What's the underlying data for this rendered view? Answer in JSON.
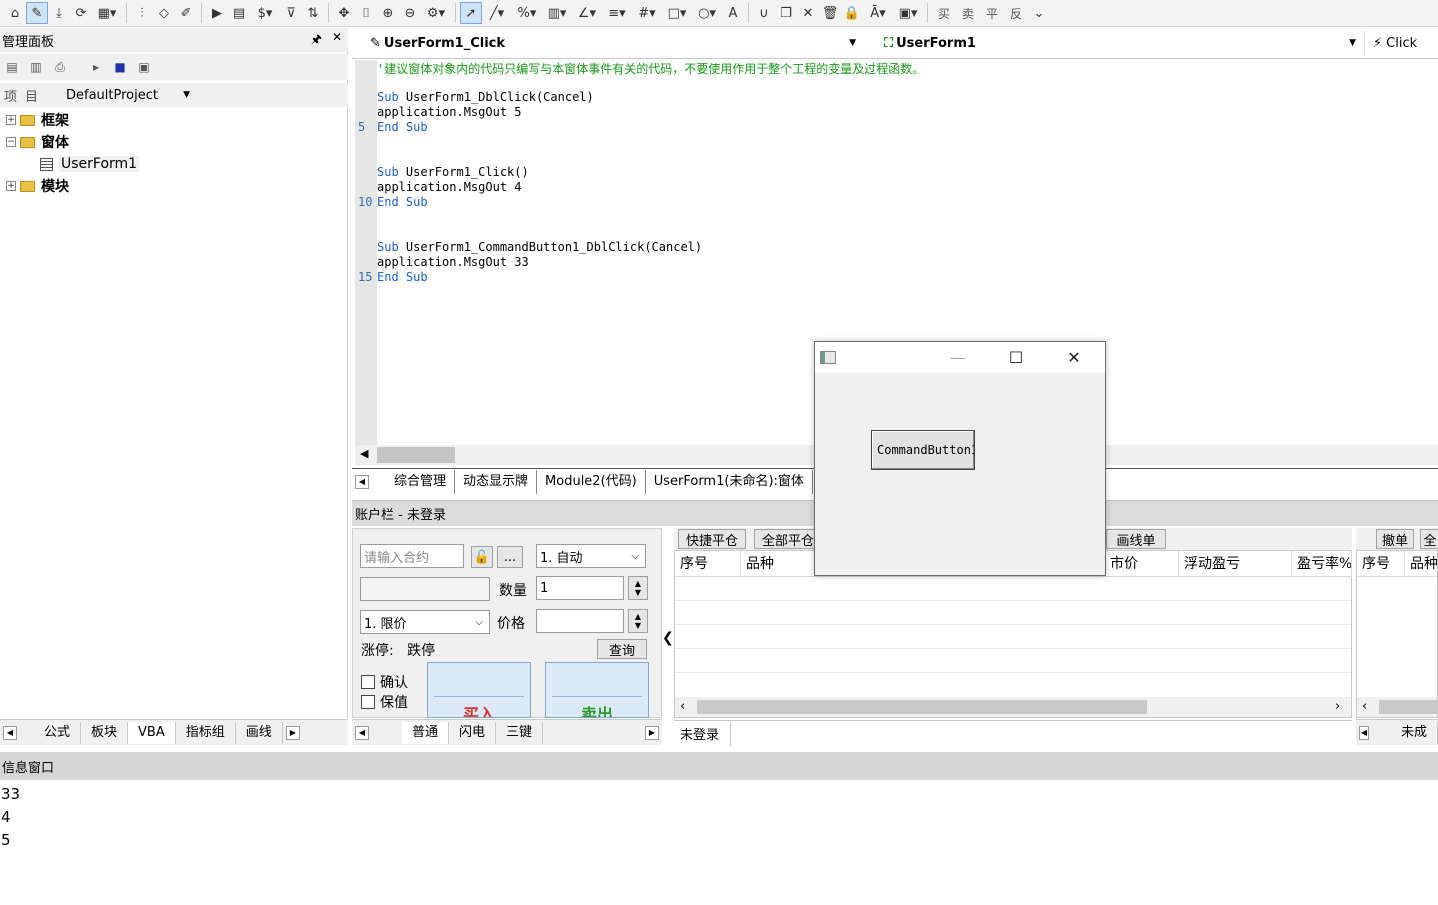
{
  "toolbar": {
    "icons": [
      "home-icon",
      "ruler-pen-icon",
      "download-icon",
      "sync-icon",
      "grid-icon",
      "bars-icon",
      "diamond-icon",
      "edit-icon",
      "play-icon",
      "document-icon",
      "dollar-icon",
      "filter-icon",
      "split-icon",
      "move-icon",
      "bracket-icon",
      "zoom-in-icon",
      "zoom-out-icon",
      "settings-icon",
      "cursor-icon",
      "line-icon",
      "percent-icon",
      "scale-icon",
      "angle-icon",
      "parallel-icon",
      "grid-lines-icon",
      "rectangle-icon",
      "circle-icon",
      "letter-a-icon",
      "magnet-icon",
      "copy-icon",
      "delete-icon",
      "trash-icon",
      "lock-icon",
      "text-a-icon",
      "save-icon"
    ],
    "text_buttons": [
      "买",
      "卖",
      "平",
      "反"
    ]
  },
  "left_panel": {
    "title": "管理面板",
    "pin": "🖈",
    "close": "✕",
    "project_label": "项目",
    "project_value": "DefaultProject",
    "tree": [
      {
        "label": "框架",
        "expand": "+",
        "indent": 0,
        "type": "folder"
      },
      {
        "label": "窗体",
        "expand": "−",
        "indent": 0,
        "type": "folder"
      },
      {
        "label": "UserForm1",
        "expand": "",
        "indent": 1,
        "type": "form"
      },
      {
        "label": "模块",
        "expand": "+",
        "indent": 0,
        "type": "folder"
      }
    ],
    "bottom_tabs": [
      "公式",
      "板块",
      "VBA",
      "指标组",
      "画线"
    ],
    "active_bottom_tab": "VBA"
  },
  "editor": {
    "procedure": "UserForm1_Click",
    "object": "UserForm1",
    "event": "Click",
    "line_numbers": [
      "5",
      "10",
      "15"
    ],
    "lines": [
      {
        "type": "comment",
        "text": "'建议窗体对象内的代码只编写与本窗体事件有关的代码，不要使用作用于整个工程的变量及过程函数。"
      },
      {
        "type": "blank",
        "text": ""
      },
      {
        "type": "code",
        "kw": "Sub",
        "text": " UserForm1_DblClick(Cancel)"
      },
      {
        "type": "plain",
        "text": "application.MsgOut 5"
      },
      {
        "type": "end",
        "text": "End Sub"
      },
      {
        "type": "blank",
        "text": ""
      },
      {
        "type": "blank",
        "text": ""
      },
      {
        "type": "code",
        "kw": "Sub",
        "text": " UserForm1_Click()"
      },
      {
        "type": "plain",
        "text": "application.MsgOut 4"
      },
      {
        "type": "end",
        "text": "End Sub"
      },
      {
        "type": "blank",
        "text": ""
      },
      {
        "type": "blank",
        "text": ""
      },
      {
        "type": "code",
        "kw": "Sub",
        "text": " UserForm1_CommandButton1_DblClick(Cancel)"
      },
      {
        "type": "plain",
        "text": "application.MsgOut 33"
      },
      {
        "type": "end",
        "text": "End Sub"
      }
    ],
    "doc_tabs": [
      "综合管理",
      "动态显示牌",
      "Module2(代码)",
      "UserForm1(未命名):窗体"
    ]
  },
  "account": {
    "bar_text": "账户栏 - 未登录",
    "contract_placeholder": "请输入合约",
    "more_button": "...",
    "open_type": "1. 自动",
    "quantity_label": "数量",
    "quantity_value": "1",
    "price_type": "1. 限价",
    "price_label": "价格",
    "price_value": "",
    "limit_text": "涨停:   跌停",
    "query_button": "查询",
    "confirm_label": "确认",
    "keep_label": "保值",
    "buy_button": "买入",
    "sell_button": "卖出",
    "order_tabs": [
      "普通",
      "闪电",
      "三键"
    ],
    "active_order_tab": "普通"
  },
  "positions": {
    "toolbar": [
      "快捷平仓",
      "全部平仓",
      "画线单"
    ],
    "columns": [
      "序号",
      "品种",
      "",
      "",
      "",
      "",
      "市价",
      "浮动盈亏",
      "盈亏率%"
    ],
    "status": "未登录"
  },
  "right_orders": {
    "toolbar": [
      "撤单",
      "全"
    ],
    "columns": [
      "序号",
      "品种"
    ],
    "tab": "未成"
  },
  "info_window": {
    "title": "信息窗口",
    "lines": [
      "33",
      "4",
      "5"
    ]
  },
  "userform": {
    "command_button": "CommandButton1",
    "minimize": "—",
    "maximize": "☐",
    "close": "✕"
  },
  "colors": {
    "keyword": "#1e5fc9",
    "comment": "#1a9a1a",
    "line_number": "#2b6fb5",
    "buy_text": "#e03030",
    "sell_text": "#2a9a2a",
    "panel_bg": "#f0f0f0"
  }
}
